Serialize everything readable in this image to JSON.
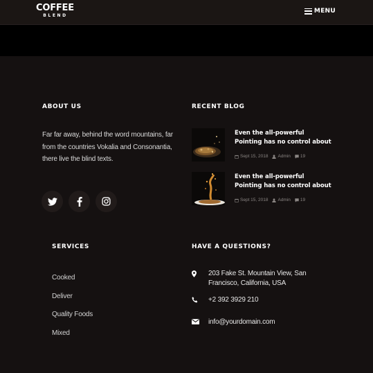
{
  "header": {
    "logo_main": "COFFEE",
    "logo_sub": "BLEND",
    "menu_label": "MENU"
  },
  "about": {
    "heading": "ABOUT US",
    "text": "Far far away, behind the word mountains, far from the countries Vokalia and Consonantia, there live the blind texts.",
    "socials": [
      {
        "icon": "twitter-icon"
      },
      {
        "icon": "facebook-icon"
      },
      {
        "icon": "instagram-icon"
      }
    ]
  },
  "recent_blog": {
    "heading": "RECENT BLOG",
    "posts": [
      {
        "title": "Even the all-powerful Pointing has no control about",
        "date": "Sept 15, 2018",
        "author": "Admin",
        "comments": "19"
      },
      {
        "title": "Even the all-powerful Pointing has no control about",
        "date": "Sept 15, 2018",
        "author": "Admin",
        "comments": "19"
      }
    ]
  },
  "services": {
    "heading": "SERVICES",
    "items": [
      "Cooked",
      "Deliver",
      "Quality Foods",
      "Mixed"
    ]
  },
  "contact": {
    "heading": "HAVE A QUESTIONS?",
    "address": "203 Fake St. Mountain View, San Francisco, California, USA",
    "phone": "+2 392 3929 210",
    "email": "info@yourdomain.com"
  }
}
